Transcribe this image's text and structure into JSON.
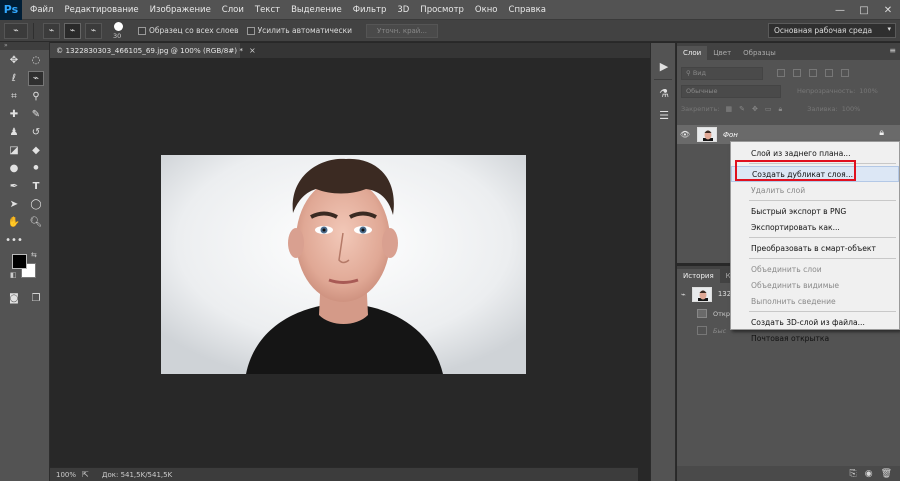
{
  "app": {
    "logo": "Ps"
  },
  "menu": [
    "Файл",
    "Редактирование",
    "Изображение",
    "Слои",
    "Текст",
    "Выделение",
    "Фильтр",
    "3D",
    "Просмотр",
    "Окно",
    "Справка"
  ],
  "window_controls": [
    "—",
    "□",
    "✕"
  ],
  "options_bar": {
    "brush_size": "30",
    "sample_all_layers": "Образец со всех слоев",
    "auto_enhance": "Усилить автоматически",
    "refine_edge": "Уточн. край...",
    "workspace": "Основная рабочая среда"
  },
  "document": {
    "tab_title": "© 1322830303_466105_69.jpg @ 100% (RGB/8#) *",
    "close": "×"
  },
  "status": {
    "zoom": "100%",
    "doc_size": "Док: 541,5K/541,5K"
  },
  "layers_panel": {
    "tabs": [
      "Слои",
      "Цвет",
      "Образцы"
    ],
    "filter_kind": "Вид",
    "blend_mode": "Обычные",
    "opacity_label": "Непрозрачность:",
    "opacity_value": "100%",
    "lock_label": "Закрепить:",
    "fill_label": "Заливка:",
    "fill_value": "100%",
    "layer_name": "Фон"
  },
  "history_panel": {
    "tabs": [
      "История",
      "К"
    ],
    "snapshot_name": "132",
    "items": [
      "Откр",
      "Быс"
    ]
  },
  "context_menu": {
    "groups": [
      [
        "Слой из заднего плана..."
      ],
      [
        "Создать дубликат слоя...",
        "Удалить слой"
      ],
      [
        "Быстрый экспорт в PNG",
        "Экспортировать как..."
      ],
      [
        "Преобразовать в смарт-объект"
      ],
      [
        "Объединить слои",
        "Объединить видимые",
        "Выполнить сведение"
      ],
      [
        "Создать 3D-слой из файла...",
        "Почтовая открытка"
      ]
    ],
    "disabled": [
      "Удалить слой",
      "Объединить слои",
      "Объединить видимые",
      "Выполнить сведение"
    ],
    "highlighted": "Создать дубликат слоя...",
    "highlight_color": "#e0101f"
  },
  "colors": {
    "foreground": "#000000",
    "background": "#ffffff"
  }
}
